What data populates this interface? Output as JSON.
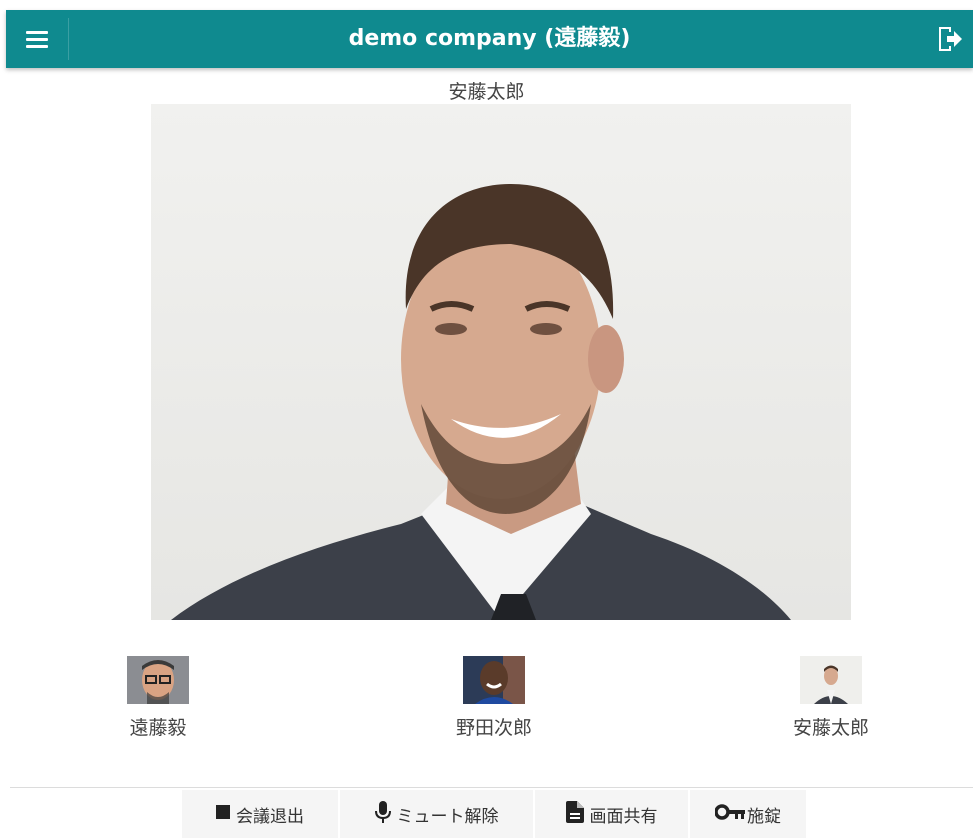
{
  "header": {
    "title": "demo company (遠藤毅)",
    "menu_icon": "hamburger-menu-icon",
    "logout_icon": "logout-icon",
    "color": "#0f8a8f"
  },
  "main_speaker": {
    "name": "安藤太郎"
  },
  "participants": [
    {
      "name": "遠藤毅"
    },
    {
      "name": "野田次郎"
    },
    {
      "name": "安藤太郎"
    }
  ],
  "toolbar": {
    "leave": {
      "label": "会議退出",
      "icon": "stop-square-icon"
    },
    "unmute": {
      "label": "ミュート解除",
      "icon": "microphone-icon"
    },
    "share": {
      "label": "画面共有",
      "icon": "document-icon"
    },
    "lock": {
      "label": "施錠",
      "icon": "key-icon"
    }
  }
}
